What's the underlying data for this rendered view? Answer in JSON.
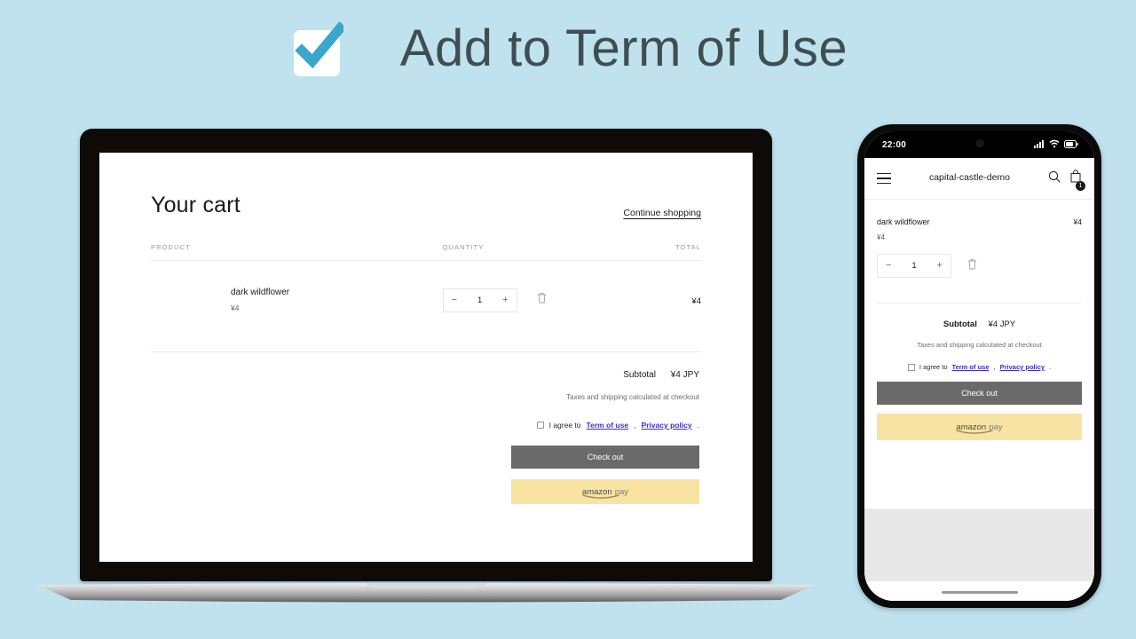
{
  "banner": {
    "icon": "checkbox-checked-icon",
    "title": "Add to Term of Use"
  },
  "colors": {
    "background": "#bfe2ee",
    "accent_check": "#3aa6cb",
    "checkout_button": "#6a6a6a",
    "amazon_pay_button": "#f8e3a3",
    "link": "#3b30c9"
  },
  "desktop": {
    "page_title": "Your cart",
    "continue_shopping": "Continue shopping",
    "columns": {
      "product": "PRODUCT",
      "quantity": "QUANTITY",
      "total": "TOTAL"
    },
    "items": [
      {
        "name": "dark wildflower",
        "price": "¥4",
        "quantity": "1",
        "decrease_label": "−",
        "increase_label": "+",
        "remove_icon": "trash-icon",
        "line_total": "¥4"
      }
    ],
    "subtotal_label": "Subtotal",
    "subtotal_value": "¥4 JPY",
    "tax_note": "Taxes and shipping calculated at checkout",
    "agreement": {
      "prefix": "I agree to",
      "link1": "Term of use",
      "separator": ",",
      "link2": "Privacy policy",
      "suffix": "."
    },
    "checkout_label": "Check out",
    "amazon_pay": {
      "word1": "amazon",
      "word2": "pay"
    }
  },
  "phone": {
    "status_bar": {
      "time": "22:00",
      "signal_icon": "cellular-signal-icon",
      "wifi_icon": "wifi-icon",
      "battery_icon": "battery-icon",
      "camera_icon": "front-camera-icon"
    },
    "header": {
      "menu_icon": "hamburger-menu-icon",
      "shop_name": "capital-castle-demo",
      "search_icon": "search-icon",
      "cart_icon": "shopping-bag-icon",
      "cart_count": "1"
    },
    "items": [
      {
        "name": "dark wildflower",
        "price": "¥4",
        "quantity": "1",
        "decrease_label": "−",
        "increase_label": "+",
        "remove_icon": "trash-icon",
        "line_total": "¥4"
      }
    ],
    "subtotal_label": "Subtotal",
    "subtotal_value": "¥4 JPY",
    "tax_note": "Taxes and shipping calculated at checkout",
    "agreement": {
      "prefix": "I agree to",
      "link1": "Term of use",
      "separator": ",",
      "link2": "Privacy policy",
      "suffix": "."
    },
    "checkout_label": "Check out",
    "amazon_pay": {
      "word1": "amazon",
      "word2": "pay"
    }
  }
}
